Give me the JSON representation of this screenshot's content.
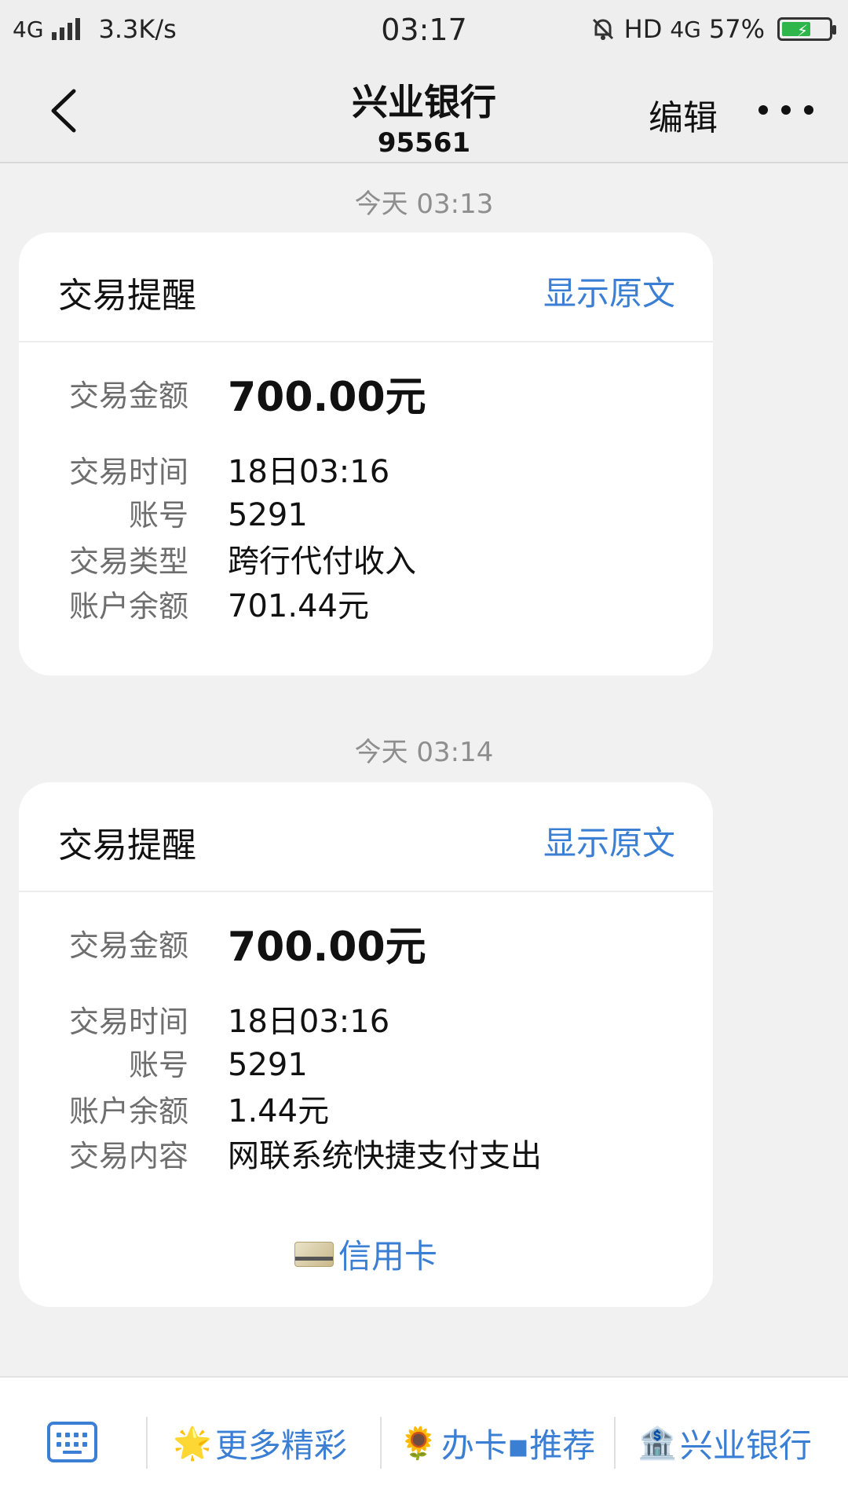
{
  "status_bar": {
    "network": "4G",
    "speed": "3.3K/s",
    "time": "03:17",
    "hd": "HD",
    "network_right": "4G",
    "battery": "57%"
  },
  "header": {
    "title": "兴业银行",
    "subtitle": "95561",
    "edit_label": "编辑"
  },
  "messages": [
    {
      "timestamp": "今天 03:13",
      "title": "交易提醒",
      "link": "显示原文",
      "amount_label": "交易金额",
      "amount": "700.00元",
      "rows": [
        {
          "label": "交易时间",
          "value": "18日03:16"
        },
        {
          "label": "账号",
          "value": "5291"
        },
        {
          "label": "交易类型",
          "value": "跨行代付收入"
        },
        {
          "label": "账户余额",
          "value": "701.44元"
        }
      ]
    },
    {
      "timestamp": "今天 03:14",
      "title": "交易提醒",
      "link": "显示原文",
      "amount_label": "交易金额",
      "amount": "700.00元",
      "rows": [
        {
          "label": "交易时间",
          "value": "18日03:16"
        },
        {
          "label": "账号",
          "value": "5291"
        },
        {
          "label": "账户余额",
          "value": "1.44元"
        },
        {
          "label": "交易内容",
          "value": "网联系统快捷支付支出"
        }
      ],
      "extra_link": "信用卡"
    }
  ],
  "bottom_bar": {
    "items": [
      {
        "emoji": "🌟",
        "label": "更多精彩"
      },
      {
        "emoji": "🌻",
        "label": "办卡▪推荐"
      },
      {
        "emoji": "🏦",
        "label": "兴业银行"
      }
    ]
  },
  "colors": {
    "accent": "#3b7fd4",
    "background": "#f1f1f1",
    "card": "#ffffff"
  }
}
